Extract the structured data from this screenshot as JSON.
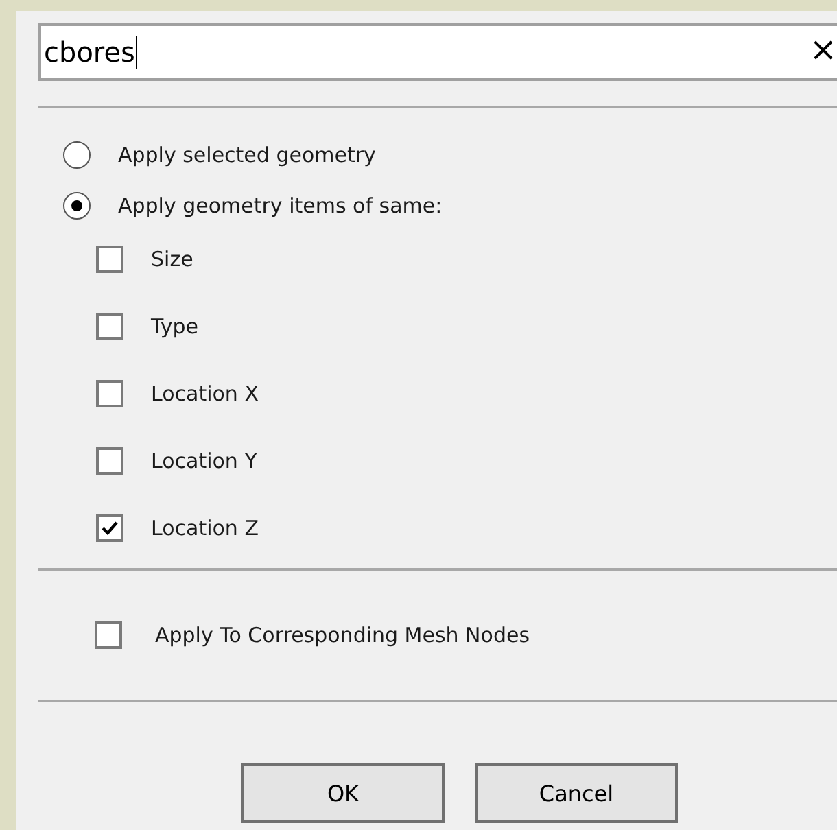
{
  "search": {
    "value": "cbores",
    "clear_glyph": "×"
  },
  "apply_mode": [
    {
      "label": "Apply selected geometry",
      "selected": false
    },
    {
      "label": "Apply geometry items of same:",
      "selected": true
    }
  ],
  "same_items": [
    {
      "label": "Size",
      "checked": false
    },
    {
      "label": "Type",
      "checked": false
    },
    {
      "label": "Location X",
      "checked": false
    },
    {
      "label": "Location Y",
      "checked": false
    },
    {
      "label": "Location Z",
      "checked": true
    }
  ],
  "mesh_option": {
    "label": "Apply To Corresponding Mesh Nodes",
    "checked": false
  },
  "buttons": [
    "OK",
    "Cancel"
  ]
}
